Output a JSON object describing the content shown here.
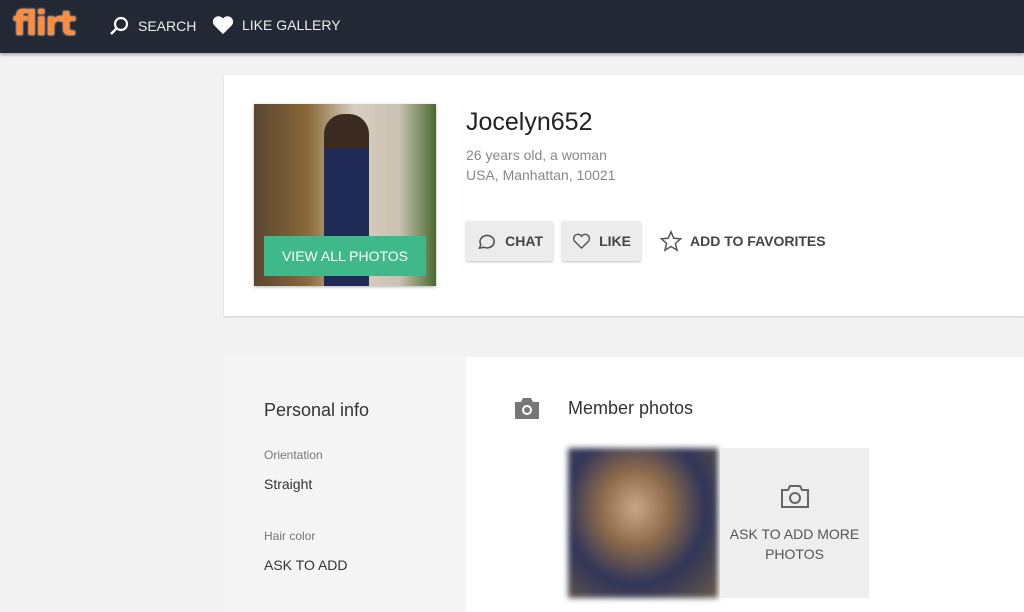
{
  "header": {
    "logo": "flirt",
    "search": "SEARCH",
    "like_gallery": "LIKE GALLERY"
  },
  "profile": {
    "username": "Jocelyn652",
    "age_gender": "26 years old, a woman",
    "location": "USA, Manhattan, 10021",
    "view_all_photos": "VIEW ALL PHOTOS",
    "chat": "CHAT",
    "like": "LIKE",
    "add_to_favorites": "ADD TO FAVORITES"
  },
  "personal_info": {
    "title": "Personal info",
    "fields": [
      {
        "label": "Orientation",
        "value": "Straight"
      },
      {
        "label": "Hair color",
        "value": "ASK TO ADD"
      }
    ]
  },
  "member_photos": {
    "title": "Member photos",
    "ask_more": "ASK TO ADD MORE PHOTOS"
  },
  "colors": {
    "header_bg": "#222834",
    "accent_green": "#3fb98a"
  }
}
